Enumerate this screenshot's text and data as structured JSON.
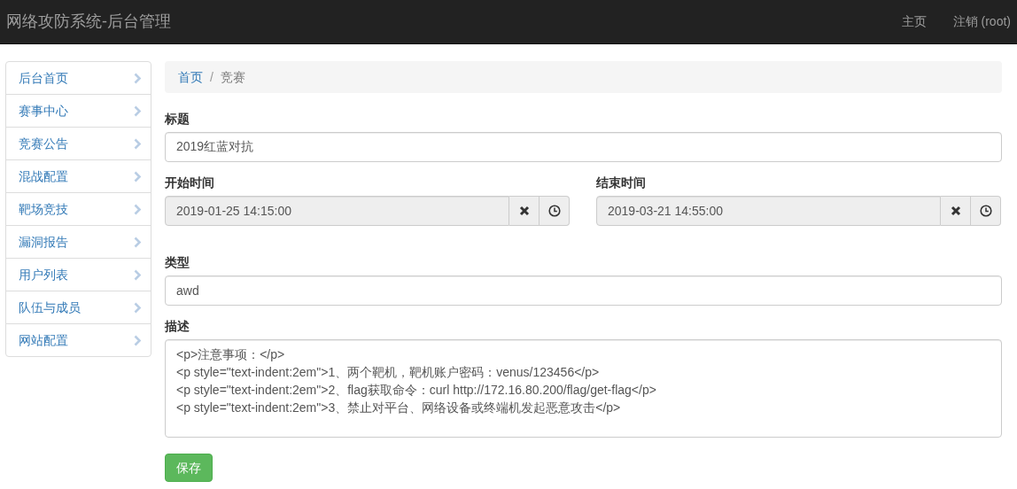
{
  "navbar": {
    "brand": "网络攻防系统-后台管理",
    "links": [
      "主页",
      "注销 (root)"
    ]
  },
  "sidebar": {
    "items": [
      {
        "label": "后台首页"
      },
      {
        "label": "赛事中心"
      },
      {
        "label": "竞赛公告"
      },
      {
        "label": "混战配置"
      },
      {
        "label": "靶场竞技"
      },
      {
        "label": "漏洞报告"
      },
      {
        "label": "用户列表"
      },
      {
        "label": "队伍与成员"
      },
      {
        "label": "网站配置"
      }
    ]
  },
  "breadcrumb": [
    {
      "label": "首页",
      "current": false
    },
    {
      "separator": "/",
      "label": "竞赛",
      "current": true
    }
  ],
  "form": {
    "title": {
      "label": "标题",
      "value": "2019红蓝对抗",
      "readonly": false
    },
    "start_time": {
      "label": "开始时间",
      "value": "2019-01-25 14:15:00",
      "readonly": true
    },
    "end_time": {
      "label": "结束时间",
      "value": "2019-03-21 14:55:00",
      "readonly": true
    },
    "type": {
      "label": "类型",
      "value": "awd",
      "readonly": false
    },
    "description": {
      "label": "描述",
      "lines": [
        "<p>注意事项：</p>",
        "<p style=\"text-indent:2em\">1、两个靶机，靶机账户密码：venus/123456</p>",
        "<p style=\"text-indent:2em\">2、flag获取命令：curl http://172.16.80.200/flag/get-flag</p>",
        "<p style=\"text-indent:2em\">3、禁止对平台、网络设备或终端机发起恶意攻击</p>"
      ]
    },
    "save_button": "保存"
  }
}
